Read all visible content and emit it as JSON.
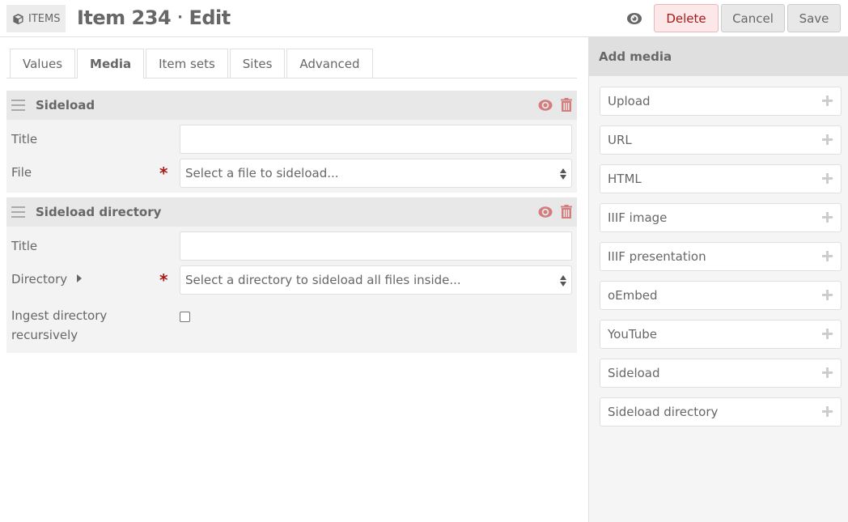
{
  "header": {
    "breadcrumb_label": "ITEMS",
    "breadcrumb_icon": "cube-icon",
    "title": "Item 234",
    "separator": "·",
    "subtitle": "Edit",
    "buttons": {
      "delete": "Delete",
      "cancel": "Cancel",
      "save": "Save"
    }
  },
  "tabs": [
    {
      "label": "Values",
      "active": false
    },
    {
      "label": "Media",
      "active": true
    },
    {
      "label": "Item sets",
      "active": false
    },
    {
      "label": "Sites",
      "active": false
    },
    {
      "label": "Advanced",
      "active": false
    }
  ],
  "media_blocks": [
    {
      "title": "Sideload",
      "fields": {
        "title_label": "Title",
        "title_value": "",
        "file_label": "File",
        "file_placeholder": "Select a file to sideload..."
      }
    },
    {
      "title": "Sideload directory",
      "fields": {
        "title_label": "Title",
        "title_value": "",
        "directory_label": "Directory",
        "directory_placeholder": "Select a directory to sideload all files inside...",
        "recursive_label_1": "Ingest directory",
        "recursive_label_2": "recursively",
        "recursive_checked": false
      }
    }
  ],
  "required_marker": "*",
  "sidebar": {
    "title": "Add media",
    "items": [
      {
        "label": "Upload"
      },
      {
        "label": "URL"
      },
      {
        "label": "HTML"
      },
      {
        "label": "IIIF image"
      },
      {
        "label": "IIIF presentation"
      },
      {
        "label": "oEmbed"
      },
      {
        "label": "YouTube"
      },
      {
        "label": "Sideload"
      },
      {
        "label": "Sideload directory"
      }
    ]
  },
  "colors": {
    "danger": "#a91919",
    "danger_bg": "#fce8e8",
    "icon_red": "#d37e7e",
    "text": "#676767"
  }
}
